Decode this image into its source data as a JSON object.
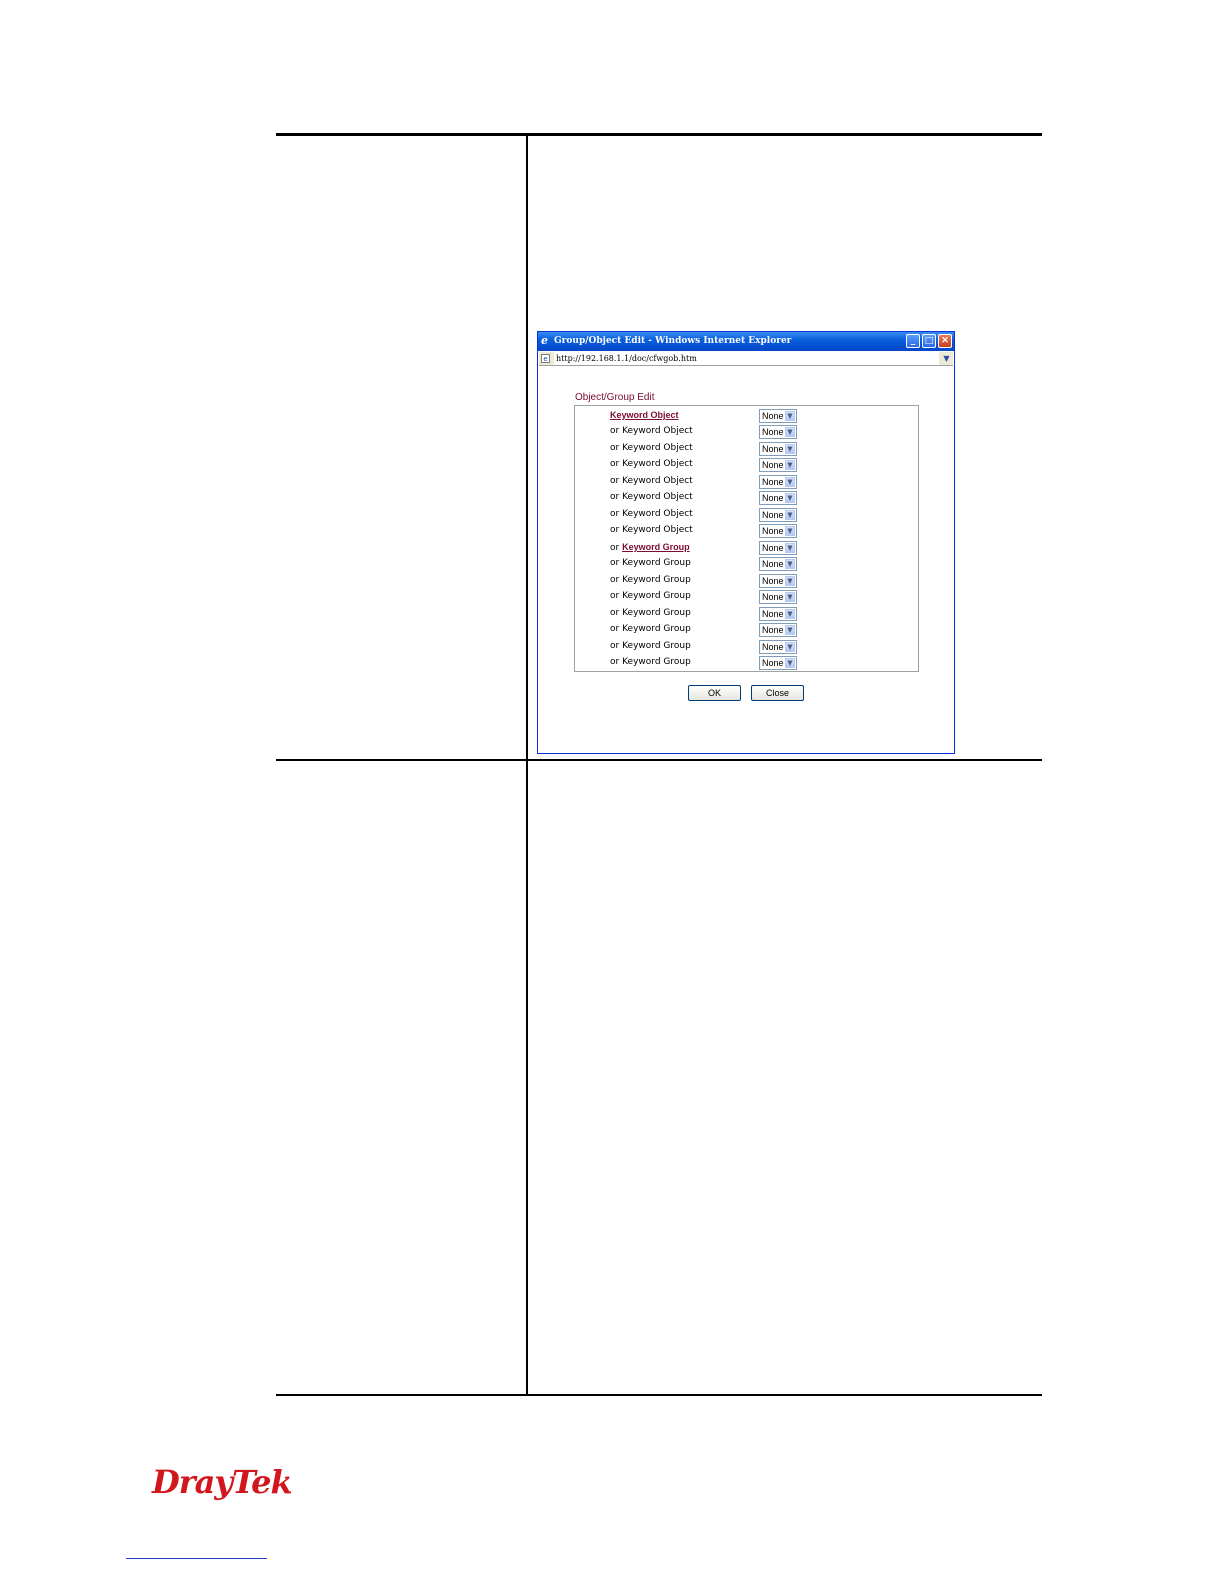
{
  "dialog": {
    "window_title": "Group/Object Edit - Windows Internet Explorer",
    "address": "http://192.168.1.1/doc/cfwgob.htm",
    "edit_title": "Object/Group Edit",
    "rows": [
      {
        "prefix": "",
        "label": "Keyword Object",
        "link": true,
        "value": "None"
      },
      {
        "prefix": "or",
        "label": "Keyword Object",
        "link": false,
        "value": "None"
      },
      {
        "prefix": "or",
        "label": "Keyword Object",
        "link": false,
        "value": "None"
      },
      {
        "prefix": "or",
        "label": "Keyword Object",
        "link": false,
        "value": "None"
      },
      {
        "prefix": "or",
        "label": "Keyword Object",
        "link": false,
        "value": "None"
      },
      {
        "prefix": "or",
        "label": "Keyword Object",
        "link": false,
        "value": "None"
      },
      {
        "prefix": "or",
        "label": "Keyword Object",
        "link": false,
        "value": "None"
      },
      {
        "prefix": "or",
        "label": "Keyword Object",
        "link": false,
        "value": "None"
      },
      {
        "prefix": "or",
        "label": "Keyword Group",
        "link": true,
        "value": "None"
      },
      {
        "prefix": "or",
        "label": "Keyword Group",
        "link": false,
        "value": "None"
      },
      {
        "prefix": "or",
        "label": "Keyword Group",
        "link": false,
        "value": "None"
      },
      {
        "prefix": "or",
        "label": "Keyword Group",
        "link": false,
        "value": "None"
      },
      {
        "prefix": "or",
        "label": "Keyword Group",
        "link": false,
        "value": "None"
      },
      {
        "prefix": "or",
        "label": "Keyword Group",
        "link": false,
        "value": "None"
      },
      {
        "prefix": "or",
        "label": "Keyword Group",
        "link": false,
        "value": "None"
      },
      {
        "prefix": "or",
        "label": "Keyword Group",
        "link": false,
        "value": "None"
      }
    ],
    "ok_label": "OK",
    "close_label": "Close"
  },
  "logo_text": "DrayTek",
  "colors": {
    "accent": "#7b0c2e",
    "logo": "#d2161e",
    "titlebar": "#0a5fdc"
  },
  "icons": [
    "ie-logo-icon",
    "minimize-icon",
    "maximize-icon",
    "close-icon",
    "page-icon",
    "dropdown-arrow-icon"
  ]
}
